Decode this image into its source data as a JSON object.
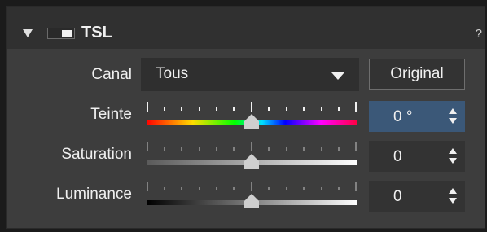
{
  "header": {
    "title": "TSL",
    "help": "?"
  },
  "canal": {
    "label": "Canal",
    "value": "Tous",
    "original_button": "Original"
  },
  "sliders": [
    {
      "label": "Teinte",
      "value": "0 °",
      "position": 0.5,
      "active": true
    },
    {
      "label": "Saturation",
      "value": "0",
      "position": 0.5,
      "active": false
    },
    {
      "label": "Luminance",
      "value": "0",
      "position": 0.5,
      "active": false
    }
  ]
}
